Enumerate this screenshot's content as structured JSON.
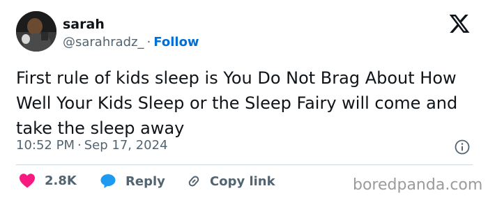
{
  "author": {
    "display_name": "sarah",
    "handle": "@sarahradz_",
    "separator": "·",
    "follow_label": "Follow"
  },
  "tweet": {
    "text": "First rule of kids sleep is You Do Not Brag About How Well Your Kids Sleep or the Sleep Fairy will come and take the sleep away",
    "time": "10:52 PM",
    "date_separator": "·",
    "date": "Sep 17, 2024"
  },
  "actions": {
    "like_count": "2.8K",
    "reply_label": "Reply",
    "copy_label": "Copy link"
  },
  "watermark": "boredpanda.com",
  "icons": [
    "x-logo-icon",
    "info-icon",
    "heart-icon",
    "speech-bubble-icon",
    "link-icon"
  ],
  "colors": {
    "text": "#0f1419",
    "secondary": "#536471",
    "follow": "#006fd6",
    "heart": "#f91880",
    "reply_bubble": "#1d9bf0",
    "divider": "#cfd9de",
    "watermark": "#9b9b9b"
  }
}
